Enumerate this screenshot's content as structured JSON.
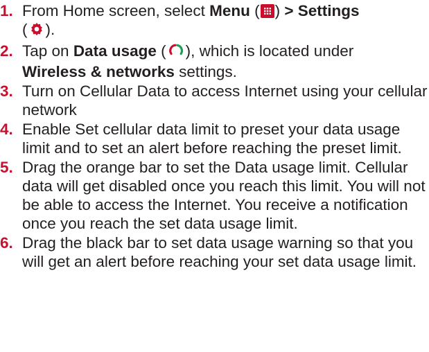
{
  "steps": [
    {
      "number": "1.",
      "prefix": "From Home screen, select ",
      "menu_label": "Menu",
      "paren_open": " (",
      "paren_close": ") ",
      "arrow_settings": "> Settings",
      "paren_open2": " (",
      "paren_close2": ")."
    },
    {
      "number": "2.",
      "prefix": "Tap on ",
      "data_usage": "Data usage",
      "paren_open": " (",
      "paren_close": "), which is located under ",
      "wireless": "Wireless & networks",
      "suffix": " settings."
    },
    {
      "number": "3.",
      "text": "Turn on Cellular Data to access Internet using your cellular network"
    },
    {
      "number": "4.",
      "text": "Enable Set cellular data limit to preset your data usage limit and to set an alert before reaching the preset limit."
    },
    {
      "number": "5.",
      "text": "Drag the orange bar to set the Data usage limit. Cellular data will get disabled once you reach this limit. You will not be able to access the Internet. You receive a notification once you reach the set data usage limit."
    },
    {
      "number": "6.",
      "text": "Drag the black bar to set data usage warning so that you will get an alert before reaching your set data usage limit."
    }
  ],
  "icons": {
    "menu": "menu-grid-icon",
    "settings": "gear-icon",
    "data_usage": "data-usage-icon"
  },
  "colors": {
    "step_number": "#c8102e",
    "icon": "#c8102e",
    "text": "#231f20"
  }
}
